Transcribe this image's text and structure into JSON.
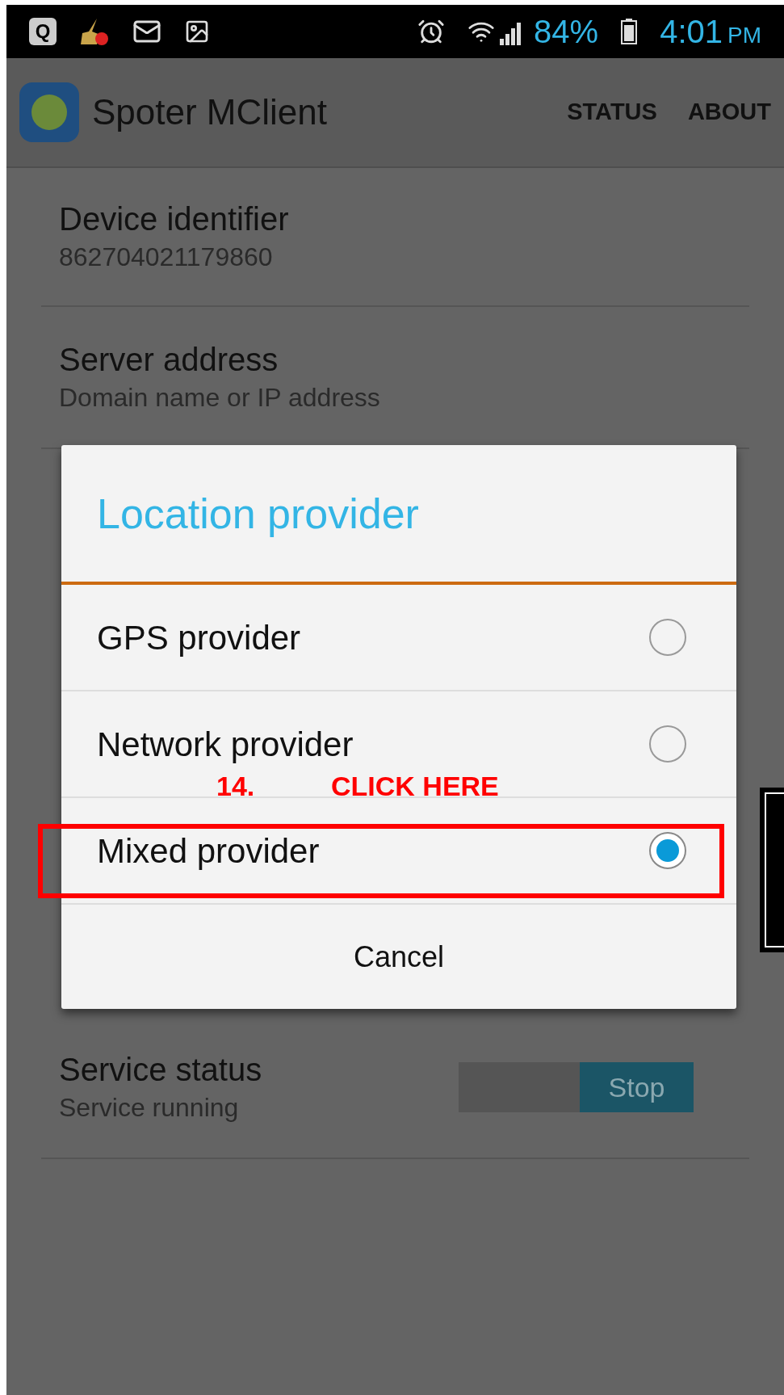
{
  "status_bar": {
    "app_letter": "Q",
    "battery": "84%",
    "time": "4:01",
    "meridiem": "PM"
  },
  "app_bar": {
    "title": "Spoter MClient",
    "actions": [
      {
        "label": "STATUS"
      },
      {
        "label": "ABOUT"
      }
    ]
  },
  "settings": [
    {
      "kind": "text",
      "title": "Device identifier",
      "summary": "862704021179860"
    },
    {
      "kind": "text",
      "title": "Server address",
      "summary": "Domain name or IP address"
    },
    {
      "kind": "switch",
      "title": "Service status",
      "summary": "Service running",
      "switch_label": "Stop",
      "on": true
    }
  ],
  "dialog": {
    "title": "Location provider",
    "options": [
      {
        "label": "GPS provider",
        "selected": false
      },
      {
        "label": "Network provider",
        "selected": false
      },
      {
        "label": "Mixed provider",
        "selected": true
      }
    ],
    "cancel": "Cancel"
  },
  "annotation": {
    "step": "14.",
    "text": "CLICK HERE"
  }
}
